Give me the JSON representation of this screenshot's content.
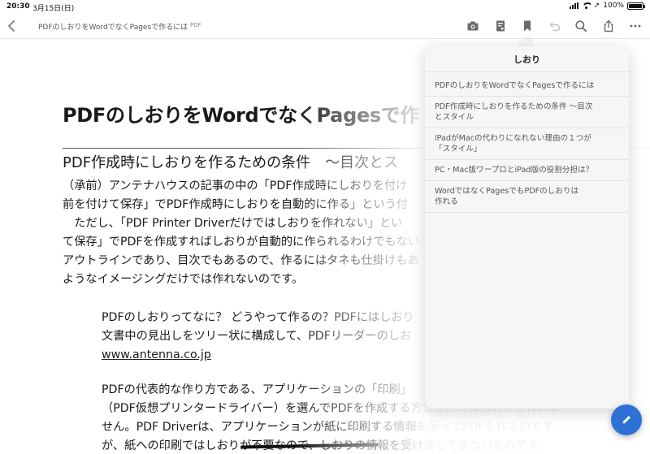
{
  "status_bar": {
    "time": "20:30",
    "date": "3月15日(日)",
    "battery": "100%",
    "battery_level": 1.0
  },
  "toolbar": {
    "back_icon": "chevron-left-icon",
    "title": "PDFのしおりをWordでなくPagesで作るには",
    "file_type": "PDF",
    "icons": [
      "camera-icon",
      "reader-view-icon",
      "bookmark-icon",
      "undo-icon",
      "search-icon",
      "share-icon",
      "more-icon"
    ]
  },
  "document": {
    "heading": "PDFのしおりをWordでなくPagesで作",
    "subheading": "PDF作成時にしおりを作るための条件　〜目次とス",
    "paragraph1": [
      "（承前）アンテナハウスの記事の中の「PDF作成時にしおりを付け",
      "前を付けて保存」でPDF作成時にしおりを自動的に作る」という付",
      "　ただし、「PDF Printer Driverだけではしおりを作れない」とい",
      "て保存」でPDFを作成すればしおりが自動的に作られるわけでもない",
      "アウトラインであり、目次でもあるので、作るにはタネも仕掛けもあ",
      "ようなイメージングだけでは作れないのです。"
    ],
    "quote1": [
      "PDFのしおりってなに？ どうやって作るの？PDFにはしおり",
      "文書中の見出しをツリー状に構成して、PDFリーダーのしお"
    ],
    "quote_link": "www.antenna.co.jp",
    "paragraph2": [
      "PDFの代表的な作り方である、アプリケーションの「印刷」",
      "（PDF仮想プリンタードライバー）を選んでPDFを作成する方法だけではしおりを作れま",
      "せん。PDF Driverは、アプリケーションが紙に印刷する情報を使ってPDFを作るのです",
      "が、紙への印刷ではしおりが不要なので、しおりの情報を受け渡しできないためです。"
    ]
  },
  "bookmarks": {
    "title": "しおり",
    "items": [
      "PDFのしおりをWordでなくPagesで作るには",
      "PDF作成時にしおりを作るための条件 〜目次\nとスタイル",
      "iPadがMacの代わりになれない理由の１つが\n「スタイル」",
      "PC・Mac版ワープロとiPad版の役割分担は？",
      "WordではなくPagesでもPDFのしおりは\n作れる"
    ]
  },
  "fab": {
    "icon": "pencil-icon",
    "color": "#2d71d6"
  },
  "colors": {
    "accent": "#2d71d6",
    "toolbar_icon": "#6b6b6b"
  }
}
